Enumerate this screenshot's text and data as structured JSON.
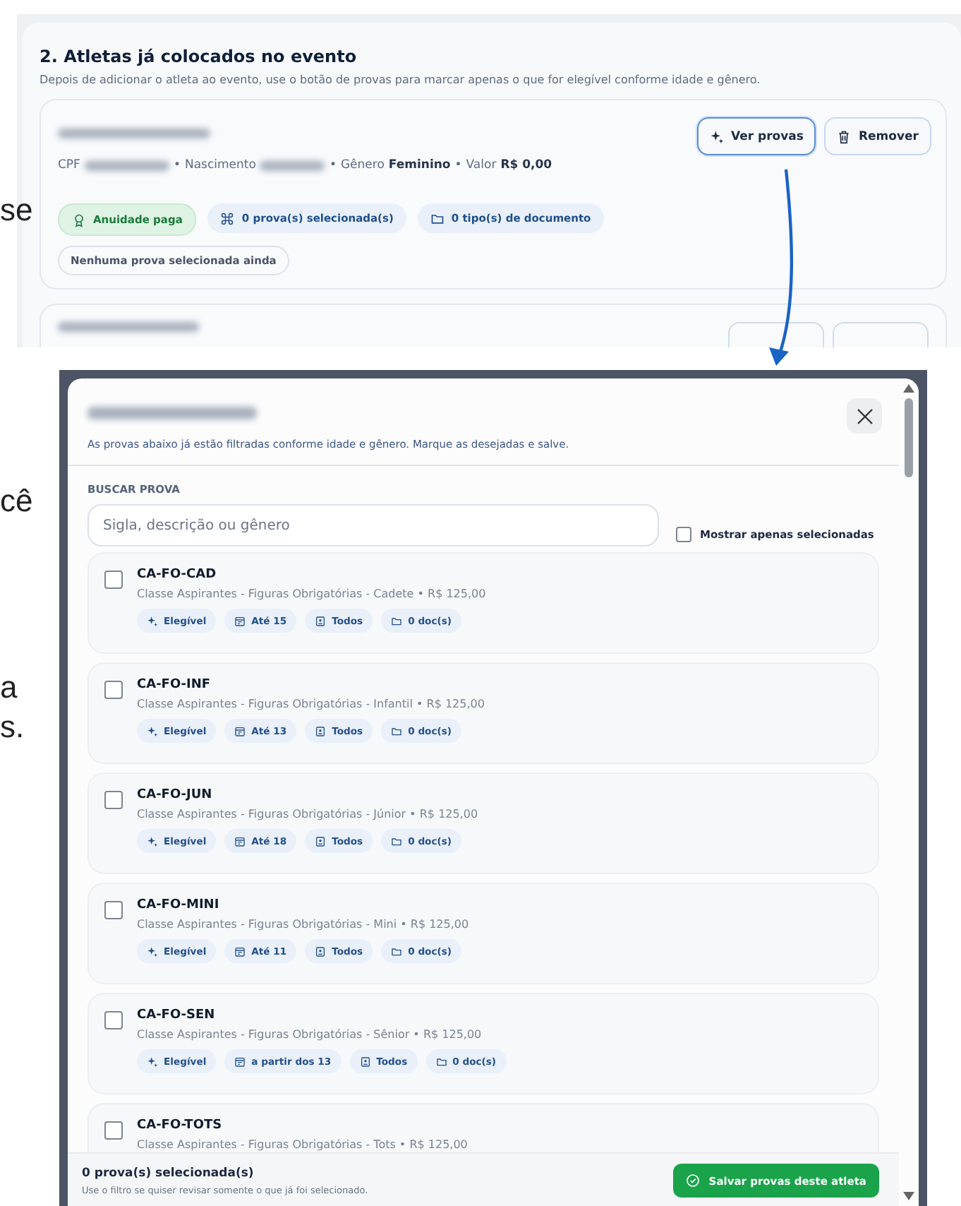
{
  "background_fragments": [
    {
      "text": "se",
      "kind": "a"
    },
    {
      "text": "cê",
      "kind": "b"
    },
    {
      "text": "a",
      "kind": "c"
    },
    {
      "text": "s.",
      "kind": "d"
    }
  ],
  "section": {
    "title": "2. Atletas já colocados no evento",
    "description": "Depois de adicionar o atleta ao evento, use o botão de provas para marcar apenas o que for elegível conforme idade e gênero.",
    "athlete": {
      "separator": "•",
      "cpf_label": "CPF",
      "birth_label": "Nascimento",
      "gender_label": "Gênero",
      "gender": "Feminino",
      "value_label": "Valor",
      "value": "R$ 0,00",
      "buttons": [
        {
          "kind": "view",
          "label": "Ver provas",
          "focused": true
        },
        {
          "kind": "remove",
          "label": "Remover",
          "focused": false
        }
      ],
      "tags": [
        {
          "kind": "fee",
          "label": "Anuidade paga"
        },
        {
          "kind": "events",
          "label": "0 prova(s) selecionada(s)"
        },
        {
          "kind": "documents",
          "label": "0 tipo(s) de documento"
        }
      ],
      "note": "Nenhuma prova selecionada ainda"
    }
  },
  "modal": {
    "subtitle": "As provas abaixo já estão filtradas conforme idade e gênero. Marque as desejadas e salve.",
    "search": {
      "label": "BUSCAR PROVA",
      "placeholder": "Sigla, descrição ou gênero"
    },
    "filter": {
      "label": "Mostrar apenas selecionadas",
      "checked": false
    },
    "events": [
      {
        "code": "CA-FO-CAD",
        "description": "Classe Aspirantes - Figuras Obrigatórias - Cadete • R$ 125,00",
        "checked": false,
        "tags": [
          {
            "kind": "eligibility",
            "label": "Elegível"
          },
          {
            "kind": "age",
            "label": "Até 15"
          },
          {
            "kind": "gender",
            "label": "Todos"
          },
          {
            "kind": "documents",
            "label": "0 doc(s)"
          }
        ]
      },
      {
        "code": "CA-FO-INF",
        "description": "Classe Aspirantes - Figuras Obrigatórias - Infantil • R$ 125,00",
        "checked": false,
        "tags": [
          {
            "kind": "eligibility",
            "label": "Elegível"
          },
          {
            "kind": "age",
            "label": "Até 13"
          },
          {
            "kind": "gender",
            "label": "Todos"
          },
          {
            "kind": "documents",
            "label": "0 doc(s)"
          }
        ]
      },
      {
        "code": "CA-FO-JUN",
        "description": "Classe Aspirantes - Figuras Obrigatórias - Júnior • R$ 125,00",
        "checked": false,
        "tags": [
          {
            "kind": "eligibility",
            "label": "Elegível"
          },
          {
            "kind": "age",
            "label": "Até 18"
          },
          {
            "kind": "gender",
            "label": "Todos"
          },
          {
            "kind": "documents",
            "label": "0 doc(s)"
          }
        ]
      },
      {
        "code": "CA-FO-MINI",
        "description": "Classe Aspirantes - Figuras Obrigatórias - Mini • R$ 125,00",
        "checked": false,
        "tags": [
          {
            "kind": "eligibility",
            "label": "Elegível"
          },
          {
            "kind": "age",
            "label": "Até 11"
          },
          {
            "kind": "gender",
            "label": "Todos"
          },
          {
            "kind": "documents",
            "label": "0 doc(s)"
          }
        ]
      },
      {
        "code": "CA-FO-SEN",
        "description": "Classe Aspirantes - Figuras Obrigatórias - Sênior • R$ 125,00",
        "checked": false,
        "tags": [
          {
            "kind": "eligibility",
            "label": "Elegível"
          },
          {
            "kind": "age",
            "label": "a partir dos 13"
          },
          {
            "kind": "gender",
            "label": "Todos"
          },
          {
            "kind": "documents",
            "label": "0 doc(s)"
          }
        ]
      },
      {
        "code": "CA-FO-TOTS",
        "description": "Classe Aspirantes - Figuras Obrigatórias - Tots • R$ 125,00",
        "checked": false
      }
    ],
    "footer": {
      "summary": "0 prova(s) selecionada(s)",
      "hint": "Use o filtro se quiser revisar somente o que já foi selecionado.",
      "save_button": "Salvar provas deste atleta"
    }
  }
}
